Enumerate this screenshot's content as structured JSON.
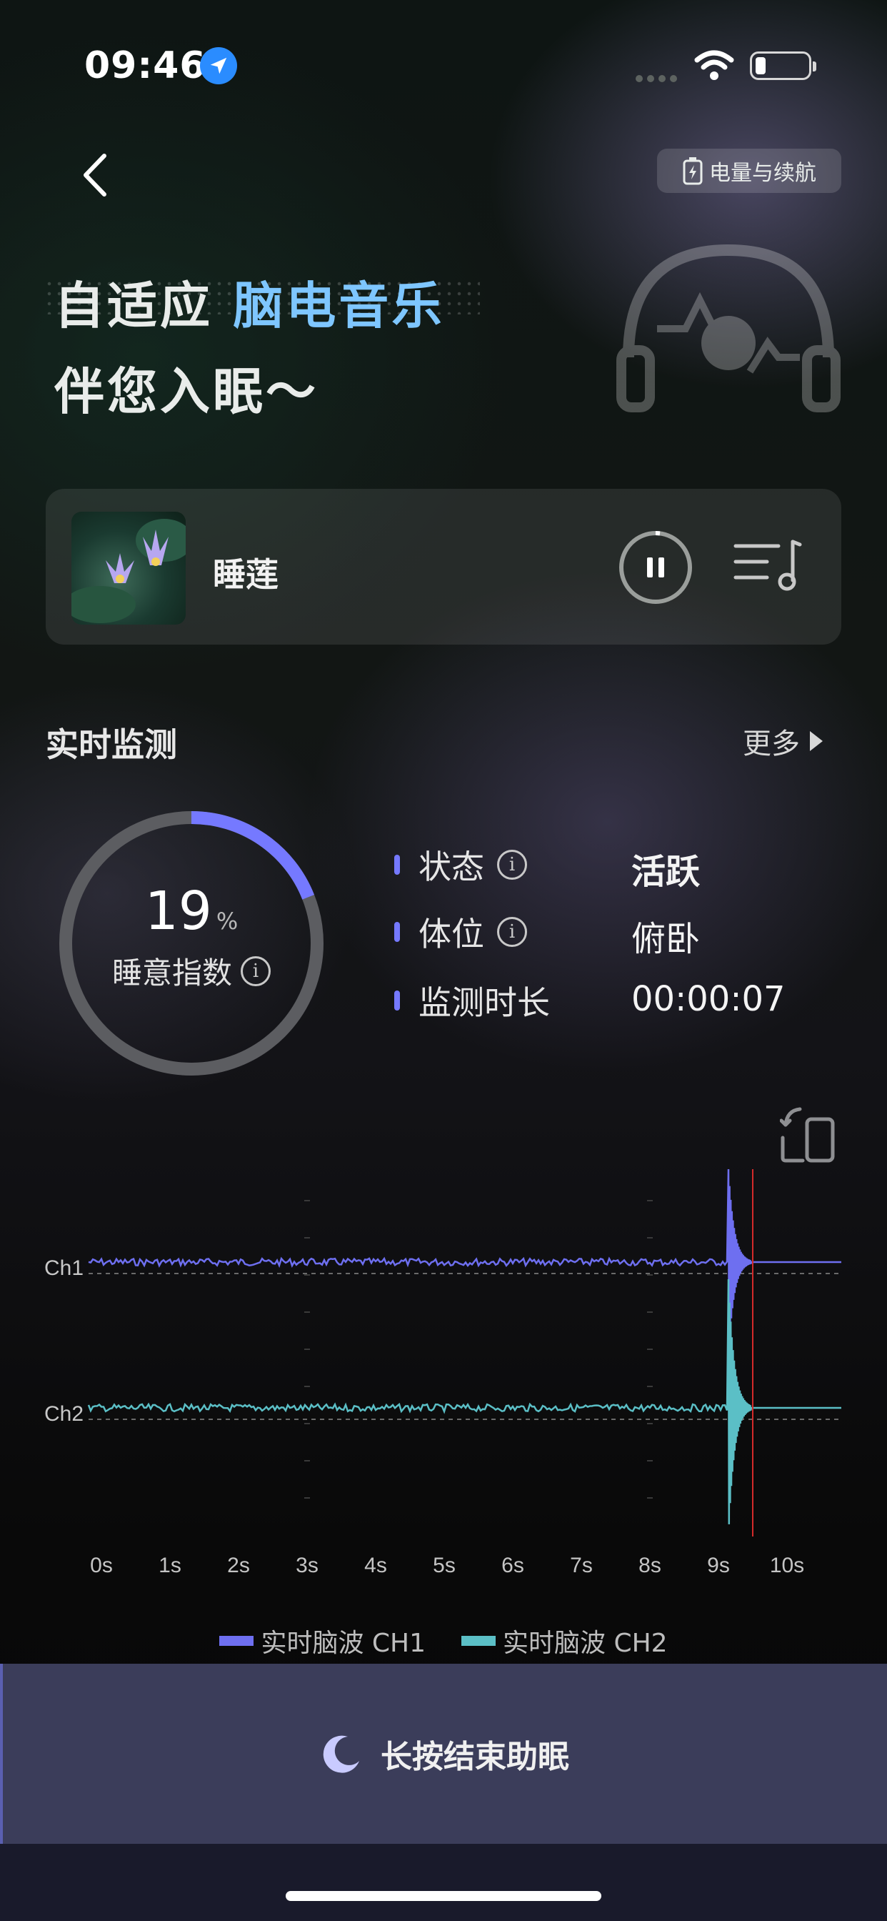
{
  "status_bar": {
    "time": "09:46",
    "icons": [
      "location-arrow-icon",
      "cellular-dots-icon",
      "wifi-icon",
      "battery-low-icon"
    ]
  },
  "nav": {
    "back_icon": "chevron-left-icon",
    "power_button_label": "电量与续航",
    "power_icon": "battery-charge-icon"
  },
  "headline": {
    "line1_prefix": "自适应",
    "line1_highlight": "脑电音乐",
    "line2": "伴您入眠～"
  },
  "player": {
    "song_title": "睡莲",
    "cover_icon": "water-lily-cover",
    "pause_icon": "pause-icon",
    "playlist_icon": "music-list-icon"
  },
  "monitor": {
    "title": "实时监测",
    "more_label": "更多",
    "sleep_index_value": "19",
    "sleep_index_unit": "%",
    "sleep_index_fraction": 0.19,
    "sleep_index_label": "睡意指数",
    "stats": [
      {
        "label": "状态",
        "value": "活跃",
        "has_info": true
      },
      {
        "label": "体位",
        "value": "俯卧",
        "has_info": true
      },
      {
        "label": "监测时长",
        "value": "00:00:07",
        "has_info": false
      }
    ],
    "info_glyph": "i"
  },
  "colors": {
    "accent": "#7579ff",
    "ch1": "#6e6ff0",
    "ch2": "#5bbfc6",
    "headline_highlight": "#7ec6ff",
    "end_bar": "#3b3d5a"
  },
  "chart_data": {
    "type": "line",
    "channel_labels": [
      "Ch1",
      "Ch2"
    ],
    "x_ticks": [
      "0s",
      "1s",
      "2s",
      "3s",
      "4s",
      "5s",
      "6s",
      "7s",
      "8s",
      "9s",
      "10s"
    ],
    "xlim": [
      0,
      10.5
    ],
    "current_time_marker": 9.5,
    "spike_time": 9.25,
    "series": [
      {
        "name": "实时脑波 CH1",
        "color": "#6e6ff0"
      },
      {
        "name": "实时脑波 CH2",
        "color": "#5bbfc6"
      }
    ]
  },
  "legend": [
    {
      "label": "实时脑波 CH1",
      "color": "#6e6ff0"
    },
    {
      "label": "实时脑波 CH2",
      "color": "#5bbfc6"
    }
  ],
  "end_button": {
    "label": "长按结束助眠",
    "icon": "moon-icon"
  }
}
